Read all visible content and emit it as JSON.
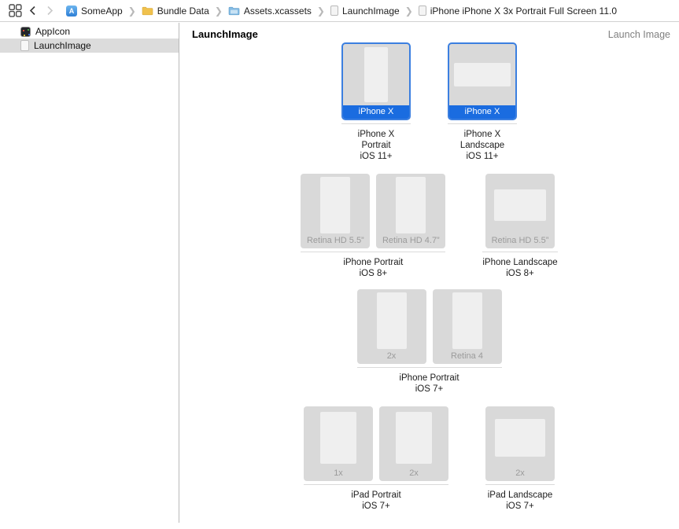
{
  "toolbar": {
    "breadcrumb": [
      {
        "label": "SomeApp",
        "icon": "app-icon"
      },
      {
        "label": "Bundle Data",
        "icon": "folder-icon"
      },
      {
        "label": "Assets.xcassets",
        "icon": "xcassets-folder-icon"
      },
      {
        "label": "LaunchImage",
        "icon": "document-icon"
      },
      {
        "label": "iPhone iPhone X 3x Portrait Full Screen 11.0",
        "icon": "document-icon"
      }
    ]
  },
  "sidebar": {
    "items": [
      {
        "label": "AppIcon",
        "icon": "appicon-asset-icon",
        "selected": false
      },
      {
        "label": "LaunchImage",
        "icon": "launchimage-asset-icon",
        "selected": true
      }
    ]
  },
  "main": {
    "title": "LaunchImage",
    "type_label": "Launch Image"
  },
  "groups": [
    {
      "caption": [
        "iPhone X",
        "Portrait",
        "iOS 11+"
      ],
      "wells": [
        {
          "label": "iPhone X",
          "selected": true
        }
      ]
    },
    {
      "caption": [
        "iPhone X",
        "Landscape",
        "iOS 11+"
      ],
      "wells": [
        {
          "label": "iPhone X",
          "selected": true
        }
      ]
    },
    {
      "caption": [
        "iPhone Portrait",
        "iOS 8+"
      ],
      "wells": [
        {
          "label": "Retina HD 5.5”"
        },
        {
          "label": "Retina HD 4.7”"
        }
      ]
    },
    {
      "caption": [
        "iPhone Landscape",
        "iOS 8+"
      ],
      "wells": [
        {
          "label": "Retina HD 5.5”"
        }
      ]
    },
    {
      "caption": [
        "iPhone Portrait",
        "iOS 7+"
      ],
      "wells": [
        {
          "label": "2x"
        },
        {
          "label": "Retina 4"
        }
      ]
    },
    {
      "caption": [
        "iPad Portrait",
        "iOS 7+"
      ],
      "wells": [
        {
          "label": "1x"
        },
        {
          "label": "2x"
        }
      ]
    },
    {
      "caption": [
        "iPad Landscape",
        "iOS 7+"
      ],
      "wells": [
        {
          "label": "2x"
        }
      ]
    }
  ],
  "colors": {
    "selection_blue": "#1a6ce0",
    "well_border_blue": "#3b7fe0",
    "well_background": "#d9d9d9"
  }
}
